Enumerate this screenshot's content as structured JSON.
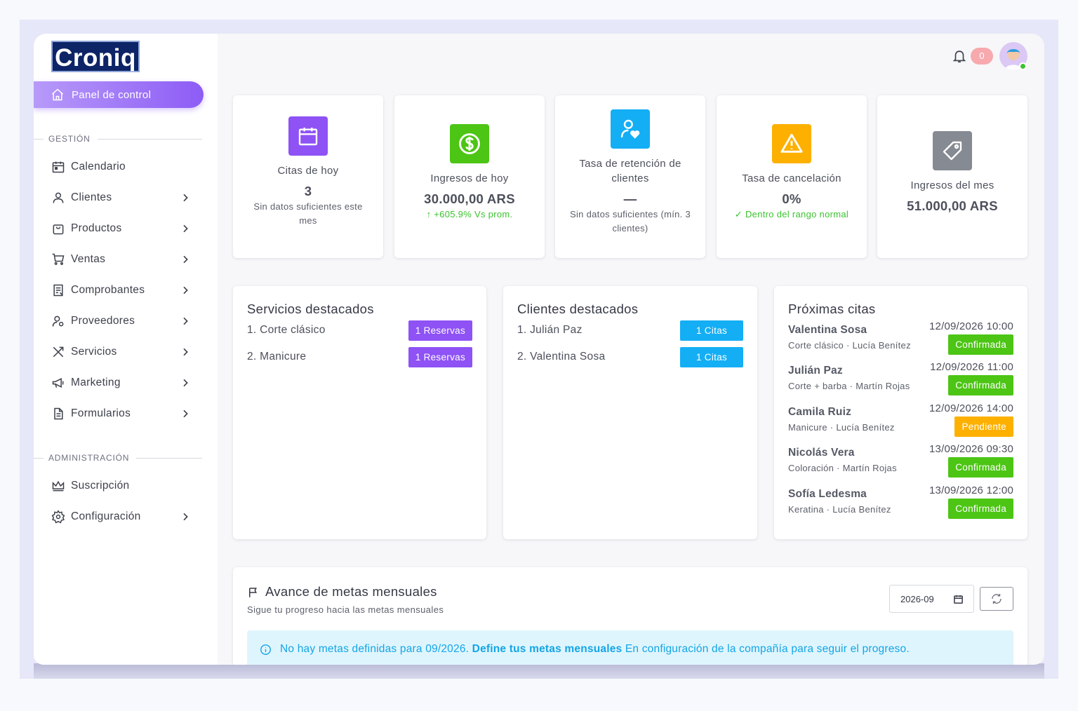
{
  "brand": {
    "logo_text": "Croniq"
  },
  "sidebar": {
    "active": {
      "label": "Panel de control",
      "icon": "home-icon"
    },
    "section_gestion": "GESTIÓN",
    "section_admin": "ADMINISTRACIÓN",
    "items": [
      {
        "label": "Calendario",
        "icon": "calendar-icon",
        "has_chevron": false
      },
      {
        "label": "Clientes",
        "icon": "user-icon",
        "has_chevron": true
      },
      {
        "label": "Productos",
        "icon": "bag-icon",
        "has_chevron": true
      },
      {
        "label": "Ventas",
        "icon": "cart-icon",
        "has_chevron": true
      },
      {
        "label": "Comprobantes",
        "icon": "receipt-icon",
        "has_chevron": true
      },
      {
        "label": "Proveedores",
        "icon": "user-gear-icon",
        "has_chevron": true
      },
      {
        "label": "Servicios",
        "icon": "tools-icon",
        "has_chevron": true
      },
      {
        "label": "Marketing",
        "icon": "megaphone-icon",
        "has_chevron": true
      },
      {
        "label": "Formularios",
        "icon": "form-icon",
        "has_chevron": true
      }
    ],
    "admin_items": [
      {
        "label": "Suscripción",
        "icon": "crown-icon",
        "has_chevron": false
      },
      {
        "label": "Configuración",
        "icon": "gear-icon",
        "has_chevron": true
      }
    ]
  },
  "topbar": {
    "notifications_count": "0"
  },
  "stats": [
    {
      "label": "Citas de hoy",
      "value": "3",
      "sub": "Sin datos suficientes este mes",
      "icon": "calendar-icon",
      "color": "#8e52f5"
    },
    {
      "label": "Ingresos de hoy",
      "value": "30.000,00 ARS",
      "sub": "↑ +605.9% Vs prom.",
      "icon": "dollar-icon",
      "color": "#4cc514"
    },
    {
      "label": "Tasa de retención de clientes",
      "value": "—",
      "sub": "Sin datos suficientes (mín. 3 clientes)",
      "icon": "user-heart-icon",
      "color": "#14aef5"
    },
    {
      "label": "Tasa de cancelación",
      "value": "0%",
      "sub": "✓ Dentro del rango normal",
      "icon": "warning-icon",
      "color": "#fdb000"
    },
    {
      "label": "Ingresos del mes",
      "value": "51.000,00 ARS",
      "sub": "",
      "icon": "tag-icon",
      "color": "#868a93"
    }
  ],
  "services": {
    "title": "Servicios destacados",
    "rows": [
      {
        "name": "1. Corte clásico",
        "badge": "1 Reservas"
      },
      {
        "name": "2. Manicure",
        "badge": "1 Reservas"
      }
    ],
    "badge_color": "#8e52f5"
  },
  "clients": {
    "title": "Clientes destacados",
    "rows": [
      {
        "name": "1. Julián Paz",
        "badge": "1 Citas"
      },
      {
        "name": "2. Valentina Sosa",
        "badge": "1 Citas"
      }
    ],
    "badge_color": "#14aef5"
  },
  "appointments": {
    "title": "Próximas citas",
    "rows": [
      {
        "name": "Valentina Sosa",
        "date": "12/09/2026 10:00",
        "detail": "Corte clásico · Lucía Benítez",
        "status": "Confirmada",
        "status_color": "#4cc514"
      },
      {
        "name": "Julián Paz",
        "date": "12/09/2026 11:00",
        "detail": "Corte + barba · Martín Rojas",
        "status": "Confirmada",
        "status_color": "#4cc514"
      },
      {
        "name": "Camila Ruiz",
        "date": "12/09/2026 14:00",
        "detail": "Manicure · Lucía Benítez",
        "status": "Pendiente",
        "status_color": "#fdb000"
      },
      {
        "name": "Nicolás Vera",
        "date": "13/09/2026 09:30",
        "detail": "Coloración · Martín Rojas",
        "status": "Confirmada",
        "status_color": "#4cc514"
      },
      {
        "name": "Sofía Ledesma",
        "date": "13/09/2026 12:00",
        "detail": "Keratina · Lucía Benítez",
        "status": "Confirmada",
        "status_color": "#4cc514"
      }
    ]
  },
  "goals": {
    "title": "Avance de metas mensuales",
    "subtitle": "Sigue tu progreso hacia las metas mensuales",
    "month_value": "2026-09",
    "alert_prefix": "No hay metas definidas para 09/2026.",
    "alert_link": "Define tus metas mensuales",
    "alert_suffix": "En configuración de la compañía para seguir el progreso."
  }
}
